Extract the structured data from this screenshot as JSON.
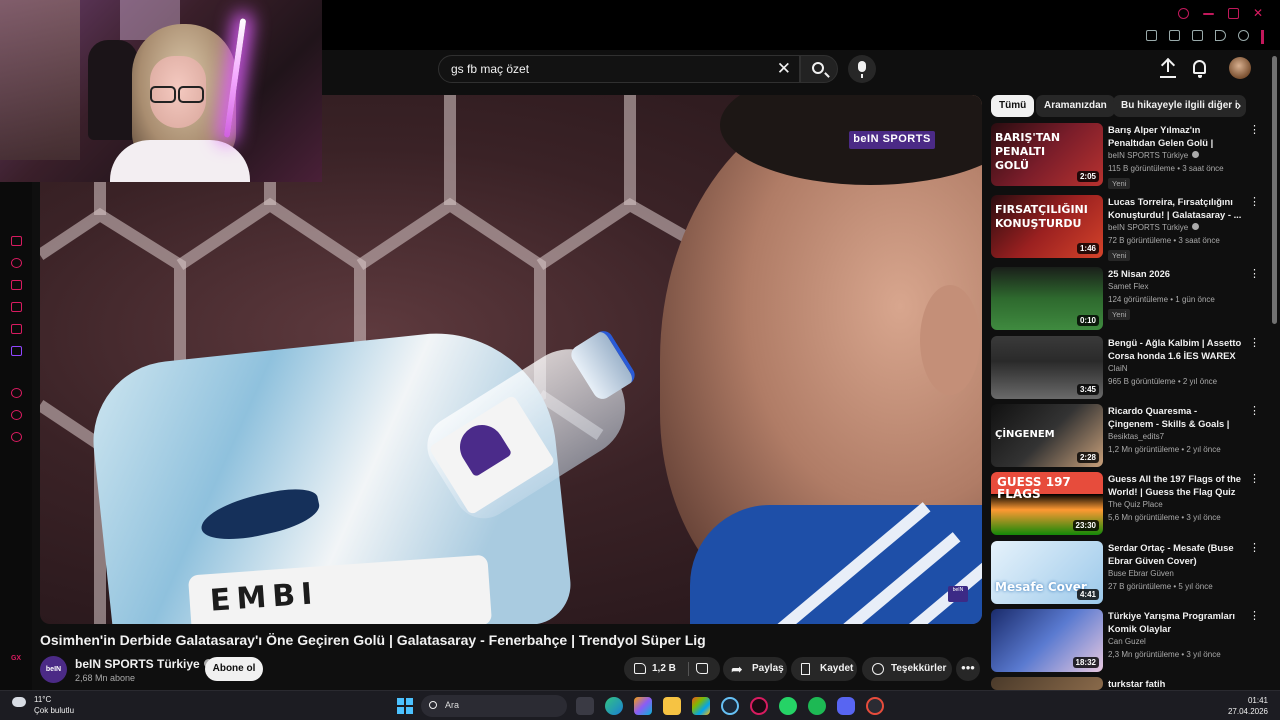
{
  "search": {
    "query": "gs fb maç özet"
  },
  "video": {
    "title": "Osimhen'in Derbide Galatasaray'ı Öne Geçiren Golü | Galatasaray - Fenerbahçe | Trendyol Süper Lig",
    "overlay_logo": "beIN SPORTS",
    "channel": {
      "name": "beIN SPORTS Türkiye",
      "avatar_text": "beIN",
      "subscribers": "2,68 Mn abone",
      "subscribe_label": "Abone ol"
    },
    "actions": {
      "likes": "1,2 B",
      "share": "Paylaş",
      "save": "Kaydet",
      "thanks": "Teşekkürler",
      "more": "•••"
    }
  },
  "chips": [
    {
      "label": "Tümü",
      "active": true
    },
    {
      "label": "Aramanızdan",
      "active": false
    },
    {
      "label": "Bu hikayeyle ilgili diğer i",
      "active": false
    }
  ],
  "recommendations": [
    {
      "title": "Barış Alper Yılmaz'ın Penaltıdan Gelen Golü | Galatasaray - ...",
      "channel": "beIN SPORTS Türkiye",
      "verified": true,
      "meta": "115 B görüntüleme • 3 saat önce",
      "badge": "Yeni",
      "duration": "2:05",
      "thumb_text": "BARIŞ'TAN PENALTI GOLÜ"
    },
    {
      "title": "Lucas Torreira, Fırsatçılığını Konuşturdu! | Galatasaray - ...",
      "channel": "beIN SPORTS Türkiye",
      "verified": true,
      "meta": "72 B görüntüleme • 3 saat önce",
      "badge": "Yeni",
      "duration": "1:46",
      "thumb_text": "FIRSATÇILIĞINI KONUŞTURDU"
    },
    {
      "title": "25 Nisan 2026",
      "channel": "Samet Flex",
      "verified": false,
      "meta": "124 görüntüleme • 1 gün önce",
      "badge": "Yeni",
      "duration": "0:10",
      "thumb_text": ""
    },
    {
      "title": "Bengü - Ağla Kalbim | Assetto Corsa honda 1.6 İES WAREX ...",
      "channel": "ClaiN",
      "verified": false,
      "meta": "965 B görüntüleme • 2 yıl önce",
      "badge": "",
      "duration": "3:45",
      "thumb_text": ""
    },
    {
      "title": "Ricardo Quaresma - Çingenem - Skills & Goals | HD",
      "channel": "Besiktas_edits7",
      "verified": false,
      "meta": "1,2 Mn görüntüleme • 2 yıl önce",
      "badge": "",
      "duration": "2:28",
      "thumb_text": "ÇİNGENEM"
    },
    {
      "title": "Guess All the 197 Flags of the World! | Guess the Flag Quiz",
      "channel": "The Quiz Place",
      "verified": false,
      "meta": "5,6 Mn görüntüleme • 3 yıl önce",
      "badge": "",
      "duration": "23:30",
      "thumb_text": "GUESS 197 FLAGS"
    },
    {
      "title": "Serdar Ortaç - Mesafe (Buse Ebrar Güven Cover)",
      "channel": "Buse Ebrar Güven",
      "verified": false,
      "meta": "27 B görüntüleme • 5 yıl önce",
      "badge": "",
      "duration": "4:41",
      "thumb_text": "Mesafe Cover"
    },
    {
      "title": "Türkiye Yarışma Programları Komik Olaylar",
      "channel": "Can Guzel",
      "verified": false,
      "meta": "2,3 Mn görüntüleme • 3 yıl önce",
      "badge": "",
      "duration": "18:32",
      "thumb_text": ""
    },
    {
      "title": "turkstar fatih",
      "channel": "",
      "verified": false,
      "meta": "",
      "badge": "",
      "duration": "",
      "thumb_text": ""
    }
  ],
  "sidebar": {
    "gx_label": "GX"
  },
  "taskbar": {
    "weather_temp": "11°C",
    "weather_desc": "Çok bulutlu",
    "search_label": "Ara",
    "time": "01:41",
    "date": "27.04.2026"
  },
  "colors": {
    "accent": "#d81b60",
    "yt_bg": "#0f0f0f",
    "bein_purple": "#4b2a86"
  }
}
